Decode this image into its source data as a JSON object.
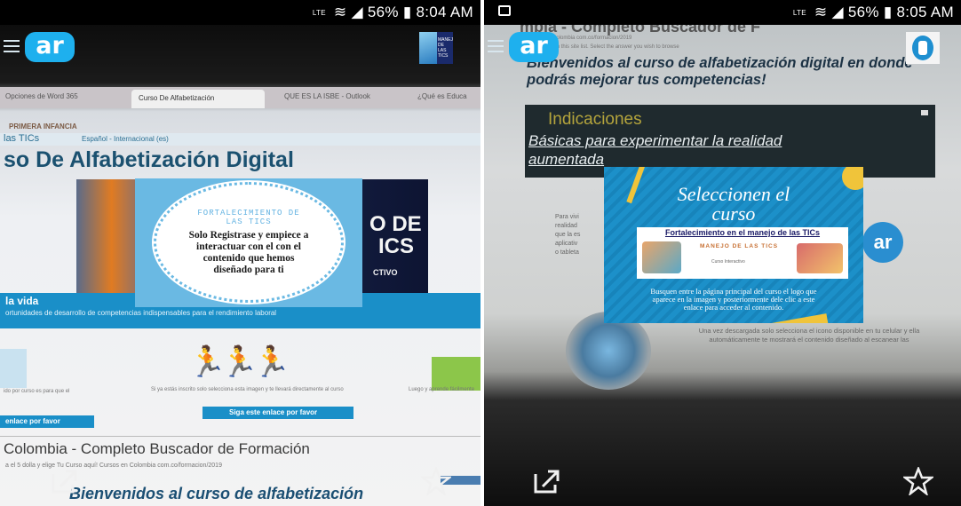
{
  "left": {
    "status": {
      "lte": "LTE",
      "battery": "56%",
      "time": "8:04 AM"
    },
    "app": {
      "logo": "ar"
    },
    "thumb_text": "MANEJO DE LAS TICS",
    "browser": {
      "tabs": [
        "Opciones de Word 365",
        "Curso De Alfabetización",
        "QUE ES LA ISBE - Outlook",
        "¿Qué es Educa"
      ],
      "bookmark": "PRIMERA INFANCIA",
      "nav_left": "las TICs",
      "nav_lang": "Español - Internacional (es)",
      "page_title": "so De Alfabetización Digital",
      "hero_right_line1": "O DE",
      "hero_right_line2": "ICS",
      "hero_right_small": "CTIVO",
      "band_title": "la vida",
      "band_sub": "ortunidades de desarrollo de competencias indispensables para el rendimiento laboral",
      "link_left": "enlace por favor",
      "link_center": "Siga este enlace por favor",
      "body_small_left": "ido por curso es para que el",
      "body_small_center": "Si ya estás inscrito solo selecciona esta imagen y te llevará directamente al curso",
      "body_small_right": "Luego y aprende fácilmente",
      "section_title": "Colombia - Completo Buscador de Formación",
      "section_url": "a el 5 dolla y elige Tu Curso aquí! Cursos en Colombia com.co/formacion/2019",
      "bottom_heading": "Bienvenidos al curso de alfabetización"
    },
    "overlay": {
      "title": "FORTALECIMIENTO DE LAS TICS",
      "body": "Solo Registrase y empiece a interactuar con el con el contenido que hemos diseñado para ti"
    }
  },
  "right": {
    "status": {
      "lte": "LTE",
      "battery": "56%",
      "time": "8:05 AM"
    },
    "app": {
      "logo": "ar"
    },
    "browser": {
      "top_text": "mbia - Completo Buscador de F",
      "url_line": "Cursos en Colombia com.co/formacion/2019",
      "url_line2": "Something on this site list. Select the answer you wish to browse",
      "heading": "Bienvenidos al curso de alfabetización digital en donde podrás mejorar tus competencias!",
      "panel_title": "Indicaciones",
      "panel_sub": "Básicas para experimentar la realidad aumentada",
      "body_lines": [
        "Para vivi",
        "realidad",
        "que la es",
        "aplicativ",
        "o tableta"
      ],
      "lower_text": "Una vez descargada solo selecciona el icono disponible en tu celular y ella automáticamente te mostrará el contenido diseñado al escanear las",
      "small_logo": "ar"
    },
    "overlay": {
      "title": "Seleccionen el curso",
      "link": "Fortalecimiento en el manejo de las TICs",
      "card_title": "MANEJO DE LAS TICS",
      "card_sub": "Curso Interactivo",
      "body": "Busquen entre la página principal del curso el logo que aparece en la imagen y posteriormente dele clic a este enlace para acceder al contenido."
    }
  },
  "icons": {
    "share": "share-icon",
    "favorite": "star-icon",
    "menu": "menu-icon"
  }
}
